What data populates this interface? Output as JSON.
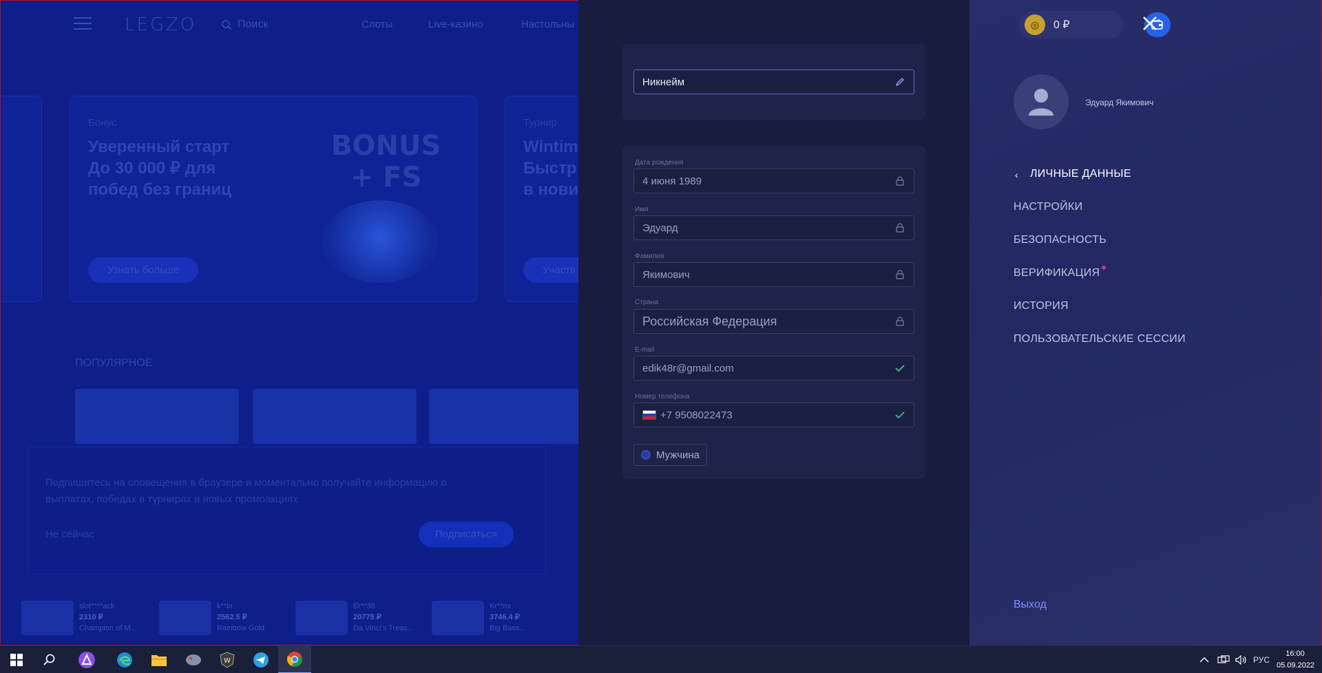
{
  "site": {
    "logo": "LEGZO",
    "search_placeholder": "Поиск",
    "nav": [
      "Слоты",
      "Live-казино",
      "Настольны"
    ],
    "promo_cards": [
      {
        "label": "Бонус",
        "title_lines": [
          "Уверенный старт",
          "До 30 000 ₽ для",
          "побед без границ"
        ],
        "button": "Узнать больше",
        "art": "BONUS\n+ FS"
      },
      {
        "label": "Турнир",
        "title_lines": [
          "Wintim",
          "Быстр",
          "в нови"
        ],
        "button": "Участв"
      }
    ],
    "popular_heading": "ПОПУЛЯРНОЕ",
    "notification": {
      "text": "Подпишитесь на оповещения в браузере и моментально получайте информацию о выплатах, победах в турнирах и новых промоакциях",
      "later": "Не сейчас",
      "subscribe": "Подписаться"
    },
    "winners": [
      {
        "name": "slot****ack",
        "amount": "2310 ₽",
        "game": "Champion of M..."
      },
      {
        "name": "k**in",
        "amount": "2562.5 ₽",
        "game": "Rainbow Gold"
      },
      {
        "name": "Er**38",
        "amount": "20775 ₽",
        "game": "Da Vinci's Treas..."
      },
      {
        "name": "Kr**nv",
        "amount": "3746.4 ₽",
        "game": "Big Bass..."
      }
    ]
  },
  "profile_form": {
    "nickname": {
      "value": "Никнейм"
    },
    "fields": [
      {
        "label": "Дата рождения",
        "value": "4 июня 1989",
        "icon": "lock-icon"
      },
      {
        "label": "Имя",
        "value": "Эдуард",
        "icon": "lock-icon"
      },
      {
        "label": "Фамилия",
        "value": "Якимович",
        "icon": "lock-icon"
      },
      {
        "label": "Страна",
        "value": "Российская Федерация",
        "icon": "lock-icon"
      },
      {
        "label": "E-mail",
        "value": "edik48r@gmail.com",
        "icon": "check-icon"
      },
      {
        "label": "Номер телефона",
        "value": "+7  9508022473",
        "icon": "check-icon"
      }
    ],
    "gender": "Мужчина"
  },
  "account_panel": {
    "balance": "0 ₽",
    "user_name": "Эдуард Якимович",
    "menu": [
      {
        "label": "ЛИЧНЫЕ ДАННЫЕ",
        "active": true
      },
      {
        "label": "НАСТРОЙКИ"
      },
      {
        "label": "БЕЗОПАСНОСТЬ"
      },
      {
        "label": "ВЕРИФИКАЦИЯ",
        "badge": true
      },
      {
        "label": "ИСТОРИЯ"
      },
      {
        "label": "ПОЛЬЗОВАТЕЛЬСКИЕ СЕССИИ"
      }
    ],
    "logout": "Выход"
  },
  "taskbar": {
    "language": "РУС",
    "time": "16:00",
    "date": "05.09.2022"
  },
  "colors": {
    "accent": "#2664e8",
    "success": "#3ec29a",
    "badge": "#d03090",
    "link": "#7a90ff"
  }
}
